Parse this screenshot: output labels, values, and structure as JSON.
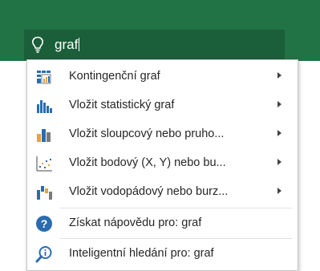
{
  "search": {
    "query": "graf"
  },
  "menu": {
    "items": [
      {
        "label": "Kontingenční graf",
        "icon": "pivot-chart-icon",
        "submenu": true
      },
      {
        "label": "Vložit statistický graf",
        "icon": "statistic-chart-icon",
        "submenu": true
      },
      {
        "label": "Vložit sloupcový nebo pruho...",
        "icon": "column-chart-icon",
        "submenu": true
      },
      {
        "label": "Vložit bodový (X, Y) nebo bu...",
        "icon": "scatter-chart-icon",
        "submenu": true
      },
      {
        "label": "Vložit vodopádový nebo burz...",
        "icon": "waterfall-chart-icon",
        "submenu": true
      }
    ],
    "help": {
      "label": "Získat nápovědu pro: graf",
      "icon": "help-icon"
    },
    "smart_lookup": {
      "label": "Inteligentní hledání pro: graf",
      "icon": "smart-lookup-icon"
    }
  },
  "colors": {
    "ribbon": "#217346",
    "search_box": "#1b5e3a",
    "accent_blue": "#2b6cb0",
    "accent_orange": "#e8a33c"
  }
}
